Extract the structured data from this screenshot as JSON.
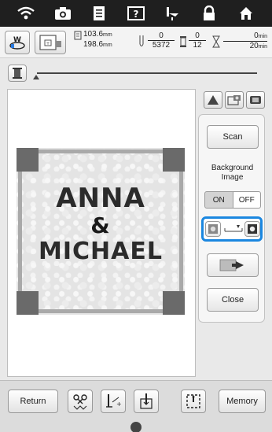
{
  "info": {
    "size_w_value": "103.6",
    "size_h_value": "198.6",
    "size_unit": "mm",
    "stitch_current": "0",
    "stitch_total": "5372",
    "color_current": "0",
    "color_total": "12",
    "time_current": "0",
    "time_total": "20",
    "time_unit": "min"
  },
  "canvas": {
    "line1": "ANNA",
    "line2": "&",
    "line3": "MICHAEL"
  },
  "panel": {
    "scan_label": "Scan",
    "background_label_1": "Background",
    "background_label_2": "Image",
    "on_label": "ON",
    "off_label": "OFF",
    "close_label": "Close"
  },
  "bottom": {
    "return_label": "Return",
    "memory_label": "Memory"
  },
  "colors": {
    "accent": "#1b87e0",
    "topbar": "#1f1f1f"
  }
}
